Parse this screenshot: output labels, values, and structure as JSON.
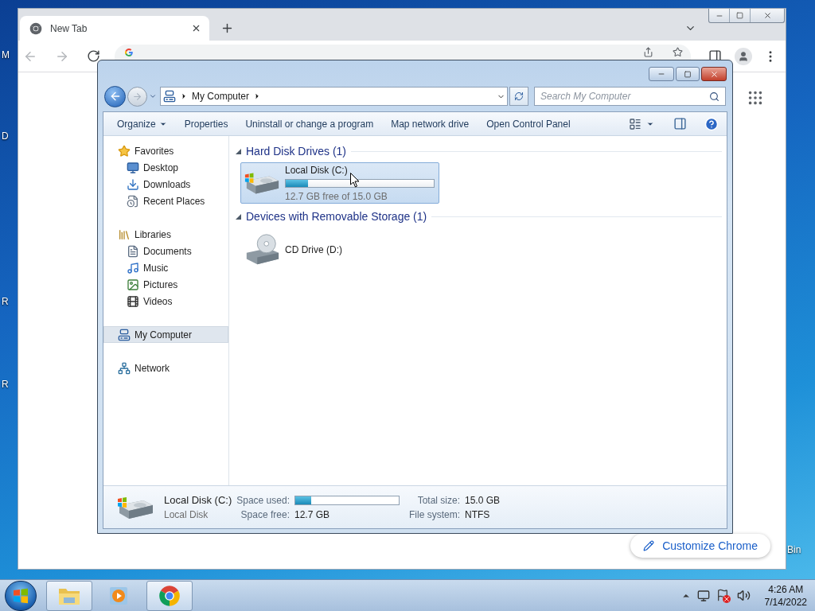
{
  "desktop": {
    "left_labels": [
      "M",
      "D",
      "R",
      "R"
    ],
    "right_labels": [
      "Bin"
    ]
  },
  "browser": {
    "tabs": [
      {
        "title": "New Tab",
        "selected": true
      }
    ],
    "customize_button": "Customize Chrome"
  },
  "explorer": {
    "breadcrumb": [
      "My Computer"
    ],
    "search": {
      "placeholder": "Search My Computer"
    },
    "commands": [
      {
        "label": "Organize",
        "kind": "menu"
      },
      {
        "label": "Properties",
        "kind": "plain"
      },
      {
        "label": "Uninstall or change a program",
        "kind": "plain"
      },
      {
        "label": "Map network drive",
        "kind": "plain"
      },
      {
        "label": "Open Control Panel",
        "kind": "plain"
      }
    ],
    "nav": [
      {
        "label": "Favorites",
        "kind": "star",
        "selected": false,
        "children": [
          {
            "label": "Desktop",
            "kind": "desktop",
            "selected": false
          },
          {
            "label": "Downloads",
            "kind": "downloads",
            "selected": false
          },
          {
            "label": "Recent Places",
            "kind": "recent",
            "selected": false
          }
        ]
      },
      {
        "label": "Libraries",
        "kind": "library",
        "selected": false,
        "children": [
          {
            "label": "Documents",
            "kind": "documents",
            "selected": false
          },
          {
            "label": "Music",
            "kind": "music",
            "selected": false
          },
          {
            "label": "Pictures",
            "kind": "pictures",
            "selected": false
          },
          {
            "label": "Videos",
            "kind": "videos",
            "selected": false
          }
        ]
      },
      {
        "label": "My Computer",
        "kind": "computer",
        "selected": true
      },
      {
        "label": "Network",
        "kind": "network",
        "selected": false
      }
    ],
    "groups": [
      {
        "title": "Hard Disk Drives (1)",
        "items": [
          {
            "name": "Local Disk (C:)",
            "kind": "disk",
            "selected": true,
            "level": 0.153,
            "free": "12.7 GB free of 15.0 GB"
          }
        ]
      },
      {
        "title": "Devices with Removable Storage (1)",
        "items": [
          {
            "name": "CD Drive (D:)",
            "kind": "cd",
            "selected": false
          }
        ]
      }
    ],
    "details": {
      "name": "Local Disk (C:)",
      "type": "Local Disk",
      "space_used": {
        "label": "Space used:",
        "level": 0.153
      },
      "space_free": {
        "label": "Space free:",
        "value": "12.7 GB"
      },
      "total_size": {
        "label": "Total size:",
        "value": "15.0 GB"
      },
      "file_system": {
        "label": "File system:",
        "value": "NTFS"
      }
    }
  },
  "taskbar": {
    "apps": [
      {
        "kind": "explorer",
        "running": true
      },
      {
        "kind": "media",
        "running": false
      },
      {
        "kind": "chrome",
        "running": true
      }
    ],
    "time": "4:26 AM",
    "date": "7/14/2022"
  }
}
